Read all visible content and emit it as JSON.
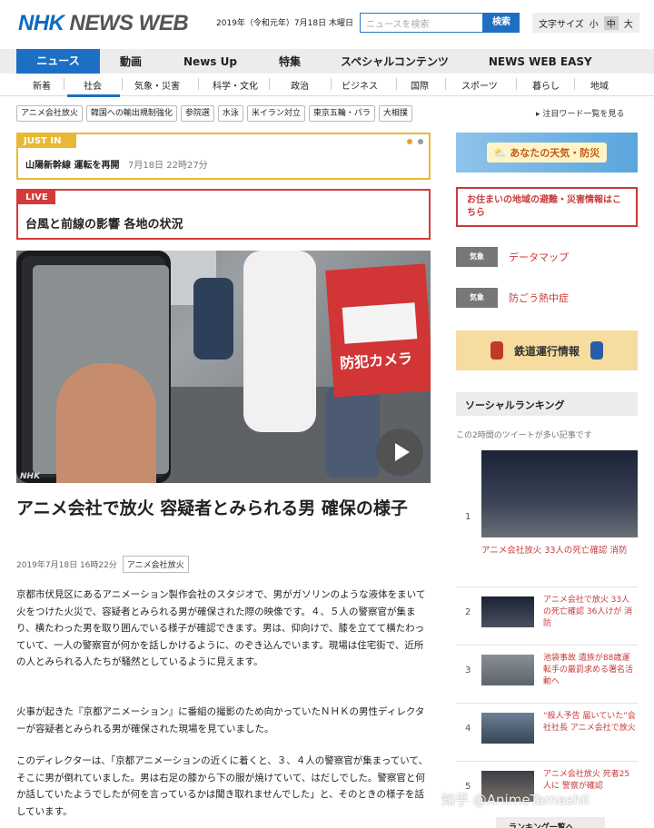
{
  "header": {
    "logo_nhk": "NHK",
    "logo_newsweb": "NEWS WEB",
    "date": "2019年（令和元年）7月18日 木曜日",
    "search_placeholder": "ニュースを検索",
    "search_button": "検索",
    "font_size_label": "文字サイズ",
    "font_sizes": [
      "小",
      "中",
      "大"
    ]
  },
  "nav": {
    "items": [
      "ニュース",
      "動画",
      "News Up",
      "特集",
      "スペシャルコンテンツ",
      "NEWS WEB EASY"
    ]
  },
  "subnav": {
    "items": [
      "新着",
      "社会",
      "気象・災害",
      "科学・文化",
      "政治",
      "ビジネス",
      "国際",
      "スポーツ",
      "暮らし",
      "地域"
    ]
  },
  "tags": {
    "items": [
      "アニメ会社放火",
      "韓国への輸出規制強化",
      "参院選",
      "水泳",
      "米イラン対立",
      "東京五輪・パラ",
      "大相撲"
    ],
    "more": "▸ 注目ワード一覧を見る"
  },
  "justin": {
    "label": "JUST IN",
    "headline": "山陽新幹線 運転を再開",
    "time": "7月18日 22時27分"
  },
  "live": {
    "label": "LIVE",
    "headline": "台風と前線の影響 各地の状況"
  },
  "photo": {
    "sign_text": "防犯カメラ",
    "watermark": "NHK"
  },
  "article": {
    "title": "アニメ会社で放火 容疑者とみられる男 確保の様子",
    "date": "2019年7月18日 16時22分",
    "tag": "アニメ会社放火",
    "para1": "京都市伏見区にあるアニメーション製作会社のスタジオで、男がガソリンのような液体をまいて火をつけた火災で、容疑者とみられる男が確保された際の映像です。４、５人の警察官が集まり、横たわった男を取り囲んでいる様子が確認できます。男は、仰向けで、膝を立てて横たわっていて、一人の警察官が何かを話しかけるように、のぞき込んでいます。現場は住宅街で、近所の人とみられる人たちが騒然としているように見えます。",
    "para2": "火事が起きた『京都アニメーション』に番組の撮影のため向かっていたＮＨＫの男性ディレクターが容疑者とみられる男が確保された現場を見ていました。",
    "para3": "このディレクターは、「京都アニメーションの近くに着くと、３、４人の警察官が集まっていて、そこに男が倒れていました。男は右足の膝から下の服が焼けていて、はだしでした。警察官と何か話していたようでしたが何を言っているかは聞き取れませんでした」と、そのときの様子を話しています。"
  },
  "sidebar": {
    "weather": "あなたの天気・防災",
    "evacuation": "お住まいの地域の避難・災害情報はこちら",
    "services": [
      {
        "badge": "気象",
        "label": "データマップ"
      },
      {
        "badge": "気象",
        "label": "防ごう熱中症"
      }
    ],
    "train": "鉄道運行情報",
    "ranking_title": "ソーシャルランキング",
    "ranking_sub": "この2時間のツイートが多い記事です",
    "ranking": [
      {
        "rank": "1",
        "text": "アニメ会社放火 33人の死亡確認 消防"
      },
      {
        "rank": "2",
        "text": "アニメ会社で放火 33人の死亡確認 36人けが 消防"
      },
      {
        "rank": "3",
        "text": "池袋事故 遺族が88歳運転手の厳罰求める署名活動へ"
      },
      {
        "rank": "4",
        "text": "“殺人予告 届いていた”会社社長 アニメ会社で放火"
      },
      {
        "rank": "5",
        "text": "アニメ会社放火 死者25人に 警察が確認"
      }
    ],
    "ranking_more": "ランキング一覧へ"
  },
  "watermark": "知乎 @AnimeTamashii"
}
